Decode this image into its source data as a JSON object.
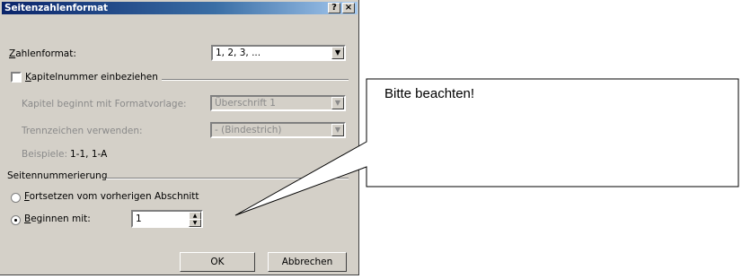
{
  "dialog": {
    "title": "Seitenzahlenformat",
    "help_glyph": "?",
    "close_glyph": "×",
    "number_format": {
      "label": "Zahlenformat:",
      "value": "1, 2, 3, ..."
    },
    "chapter": {
      "checkbox_label": "Kapitelnummer einbeziehen",
      "checked": false,
      "style_label": "Kapitel beginnt mit Formatvorlage:",
      "style_value": "Überschrift 1",
      "separator_label": "Trennzeichen verwenden:",
      "separator_value": "-   (Bindestrich)",
      "example_label": "Beispiele:",
      "example_value": "1-1, 1-A"
    },
    "numbering": {
      "group_label": "Seitennummerierung",
      "continue_label": "Fortsetzen vom vorherigen Abschnitt",
      "start_label": "Beginnen mit:",
      "start_value": "1",
      "selected": "start"
    },
    "buttons": {
      "ok": "OK",
      "cancel": "Abbrechen"
    }
  },
  "callout": {
    "text": "Bitte beachten!"
  },
  "icons": {
    "dropdown": "dropdown-arrow-icon",
    "spin_up": "spin-up-icon",
    "spin_down": "spin-down-icon"
  }
}
